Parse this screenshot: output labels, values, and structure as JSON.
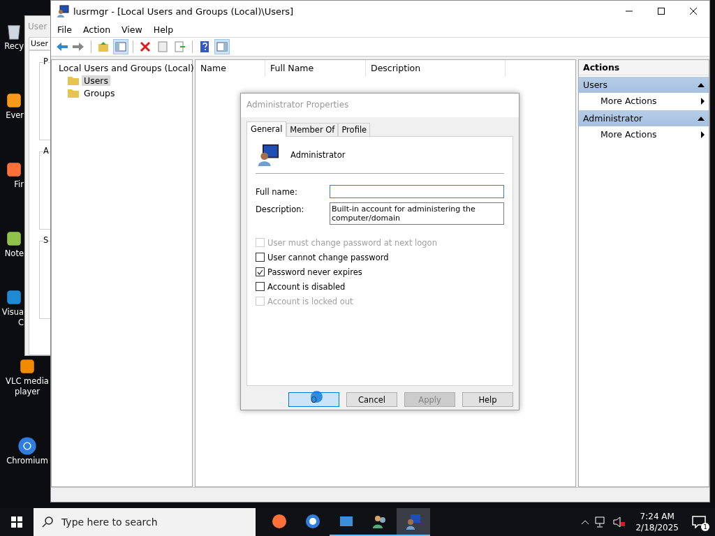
{
  "desktop_icons": [
    {
      "kind": "recycle",
      "lines": [
        "Recy"
      ]
    },
    {
      "kind": "app",
      "lines": [
        "Ever"
      ]
    },
    {
      "kind": "firefox",
      "lines": [
        "Fir"
      ]
    },
    {
      "kind": "notepad",
      "lines": [
        "Note"
      ]
    },
    {
      "kind": "vscode",
      "lines": [
        "Visua",
        "C"
      ]
    },
    {
      "kind": "vlc",
      "lines": [
        "VLC media",
        "player"
      ]
    },
    {
      "kind": "chromium",
      "lines": [
        "Chromium"
      ]
    }
  ],
  "background_window": {
    "title": "User",
    "tab": "User",
    "group_labels": [
      "P",
      "A",
      "S"
    ]
  },
  "window": {
    "title": "lusrmgr - [Local Users and Groups (Local)\\Users]"
  },
  "menu": [
    "File",
    "Action",
    "View",
    "Help"
  ],
  "toolbar": [
    {
      "kind": "back",
      "pressed": false
    },
    {
      "kind": "forward",
      "pressed": false
    },
    {
      "kind": "sep"
    },
    {
      "kind": "up",
      "pressed": false
    },
    {
      "kind": "tree",
      "pressed": true
    },
    {
      "kind": "sep"
    },
    {
      "kind": "delete",
      "pressed": false
    },
    {
      "kind": "properties",
      "pressed": false
    },
    {
      "kind": "export",
      "pressed": false
    },
    {
      "kind": "sep"
    },
    {
      "kind": "help",
      "pressed": false
    },
    {
      "kind": "pane",
      "pressed": true
    }
  ],
  "tree": {
    "label": "Local Users and Groups (Local)",
    "children": [
      {
        "label": "Users",
        "selected": true
      },
      {
        "label": "Groups",
        "selected": false
      }
    ]
  },
  "table": {
    "columns": [
      "Name",
      "Full Name",
      "Description"
    ]
  },
  "actions": {
    "title": "Actions",
    "sections": [
      {
        "title": "Users",
        "expanded": true,
        "items": [
          "More Actions"
        ]
      },
      {
        "title": "Administrator",
        "expanded": true,
        "items": [
          "More Actions"
        ]
      }
    ]
  },
  "dialog": {
    "title": "Administrator Properties",
    "tabs": [
      {
        "label": "General",
        "selected": true
      },
      {
        "label": "Member Of",
        "selected": false
      },
      {
        "label": "Profile",
        "selected": false
      }
    ],
    "user_name": "Administrator",
    "fields": [
      {
        "label": "Full name:",
        "focused": true
      },
      {
        "label": "Description:",
        "value": "Built-in account for administering the computer/domain",
        "focused": false
      }
    ],
    "checkboxes": [
      {
        "label": "User must change password at next logon",
        "checked": false,
        "disabled": true
      },
      {
        "label": "User cannot change password",
        "checked": false,
        "disabled": false
      },
      {
        "label": "Password never expires",
        "checked": true,
        "disabled": false
      },
      {
        "label": "Account is disabled",
        "checked": false,
        "disabled": false
      },
      {
        "label": "Account is locked out",
        "checked": false,
        "disabled": true
      }
    ],
    "buttons": [
      {
        "label": "O",
        "default": true,
        "disabled": false
      },
      {
        "label": "Cancel",
        "default": false,
        "disabled": false
      },
      {
        "label": "Apply",
        "default": false,
        "disabled": true
      },
      {
        "label": "Help",
        "default": false,
        "disabled": false
      }
    ]
  },
  "taskbar": {
    "search_placeholder": "Type here to search",
    "apps": [
      {
        "kind": "firefox",
        "running": false,
        "selected": false
      },
      {
        "kind": "chromium",
        "running": false,
        "selected": false
      },
      {
        "kind": "app",
        "running": true,
        "selected": false
      },
      {
        "kind": "users",
        "running": true,
        "selected": false
      },
      {
        "kind": "lusrmgr",
        "running": true,
        "selected": true
      }
    ],
    "time": "7:24 AM",
    "date": "2/18/2025",
    "notification_count": "1"
  }
}
